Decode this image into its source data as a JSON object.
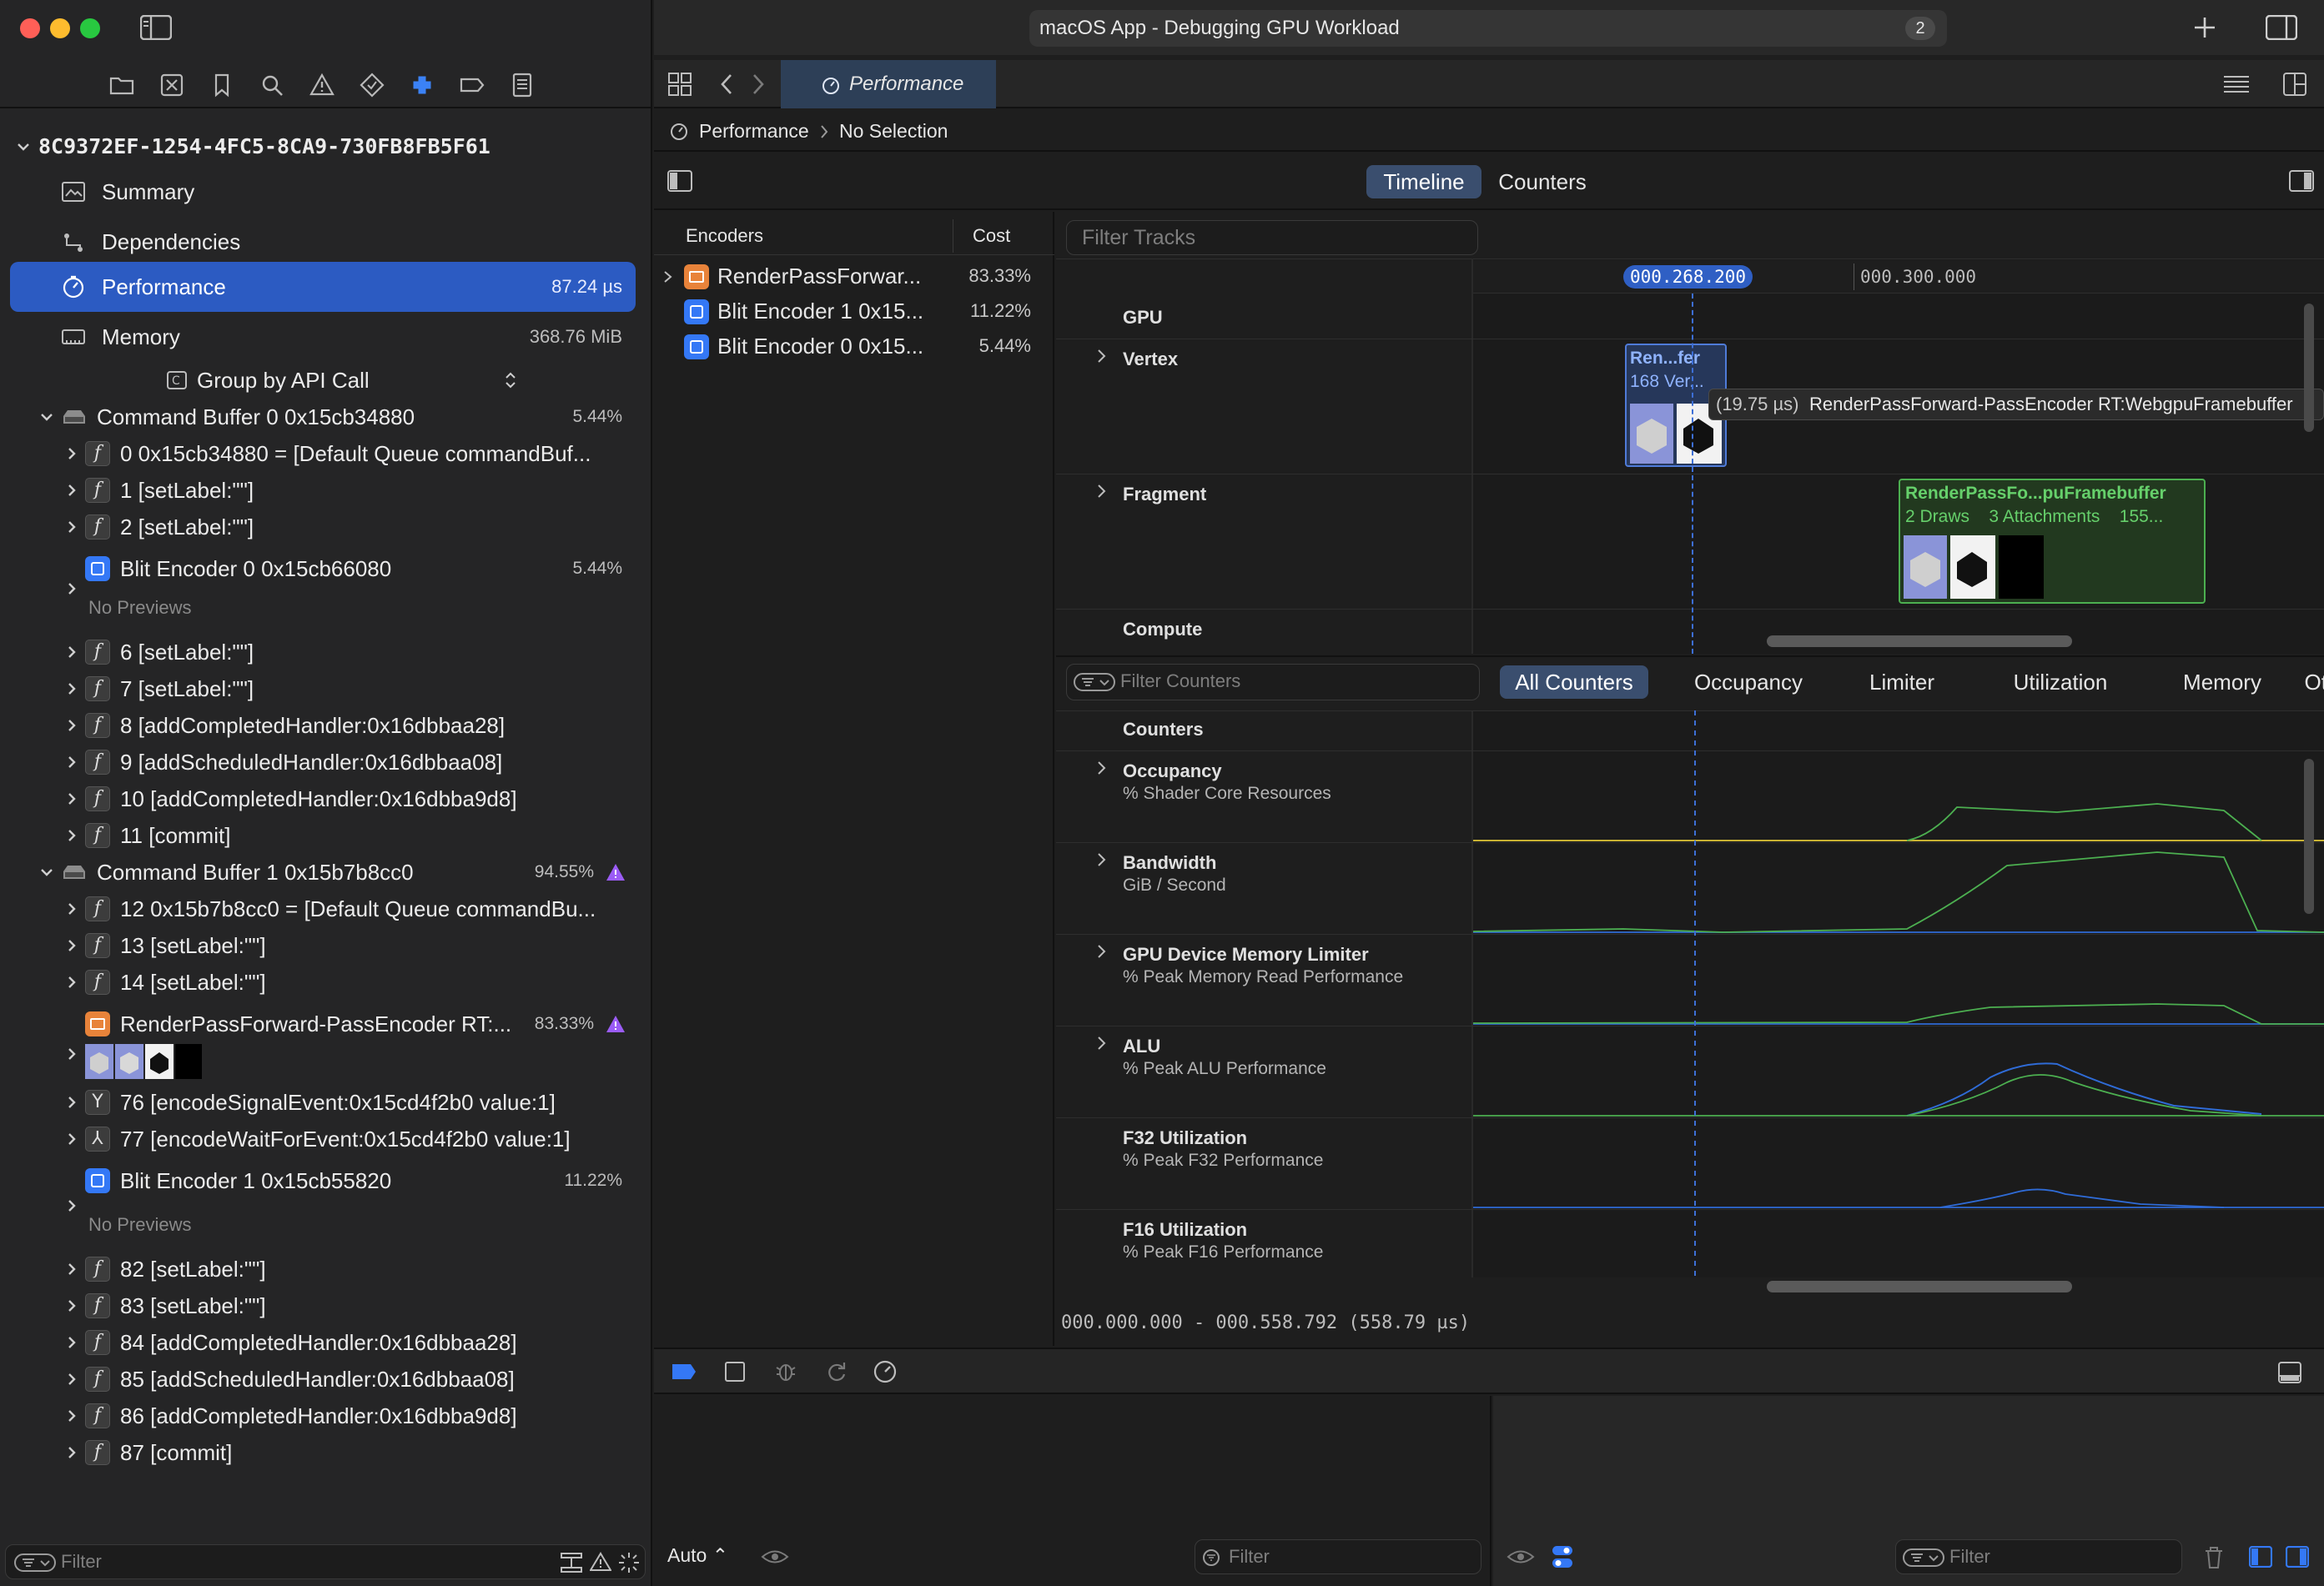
{
  "window": {
    "title": "macOS App - Debugging GPU Workload",
    "badge": "2",
    "colors": {
      "close": "#ff5f57",
      "minimize": "#febc2e",
      "zoom": "#28c840",
      "accent": "#2f5fc4",
      "selection": "#2c5bc2"
    }
  },
  "navigator": {
    "root": "8C9372EF-1254-4FC5-8CA9-730FB8FB5F61",
    "sections": [
      {
        "label": "Summary",
        "icon": "summary-icon",
        "value": ""
      },
      {
        "label": "Dependencies",
        "icon": "dependencies-icon",
        "value": ""
      },
      {
        "label": "Performance",
        "icon": "performance-icon",
        "value": "87.24 µs"
      },
      {
        "label": "Memory",
        "icon": "memory-icon",
        "value": "368.76 MiB"
      }
    ],
    "group_by": "Group by API Call",
    "command_buffer_0": {
      "label": "Command Buffer 0 0x15cb34880",
      "pct": "5.44%"
    },
    "cb0_calls": [
      "0 0x15cb34880 = [Default Queue commandBuf...",
      "1 [setLabel:\"\"]",
      "2 [setLabel:\"\"]"
    ],
    "blit0": {
      "label": "Blit Encoder 0 0x15cb66080",
      "pct": "5.44%",
      "no_previews": "No Previews"
    },
    "cb0_calls_b": [
      "6 [setLabel:\"\"]",
      "7 [setLabel:\"\"]",
      "8 [addCompletedHandler:0x16dbbaa28]",
      "9 [addScheduledHandler:0x16dbbaa08]",
      "10 [addCompletedHandler:0x16dbba9d8]",
      "11 [commit]"
    ],
    "command_buffer_1": {
      "label": "Command Buffer 1 0x15b7b8cc0",
      "pct": "94.55%"
    },
    "cb1_calls": [
      "12 0x15b7b8cc0 = [Default Queue commandBu...",
      "13 [setLabel:\"\"]",
      "14 [setLabel:\"\"]"
    ],
    "render_pass": {
      "label": "RenderPassForward-PassEncoder RT:...",
      "pct": "83.33%"
    },
    "cb1_events": [
      "76 [encodeSignalEvent:0x15cd4f2b0 value:1]",
      "77 [encodeWaitForEvent:0x15cd4f2b0 value:1]"
    ],
    "blit1": {
      "label": "Blit Encoder 1 0x15cb55820",
      "pct": "11.22%",
      "no_previews": "No Previews"
    },
    "cb1_calls_b": [
      "82 [setLabel:\"\"]",
      "83 [setLabel:\"\"]",
      "84 [addCompletedHandler:0x16dbbaa28]",
      "85 [addScheduledHandler:0x16dbbaa08]",
      "86 [addCompletedHandler:0x16dbba9d8]",
      "87 [commit]"
    ],
    "filter_placeholder": "Filter"
  },
  "editor": {
    "tab": "Performance",
    "breadcrumb": {
      "root": "Performance",
      "selection": "No Selection"
    },
    "view_tabs": [
      "Timeline",
      "Counters"
    ],
    "encoders_header": {
      "name": "Encoders",
      "cost": "Cost"
    },
    "encoders": [
      {
        "label": "RenderPassForwar...",
        "pct": "83.33%",
        "color": "#e8833a"
      },
      {
        "label": "Blit Encoder 1 0x15...",
        "pct": "11.22%",
        "color": "#3478f6"
      },
      {
        "label": "Blit Encoder 0 0x15...",
        "pct": "5.44%",
        "color": "#3478f6"
      }
    ],
    "filter_tracks": "Filter Tracks",
    "time_cursor": "000.268.200",
    "time_mark": "000.300.000",
    "tracks": [
      "GPU",
      "Vertex",
      "Fragment",
      "Compute"
    ],
    "vertex_block": {
      "title": "Ren...fer",
      "sub": "168 Ver...",
      "tooltip_time": "(19.75 µs)",
      "tooltip_label": "RenderPassForward-PassEncoder RT:WebgpuFramebuffer"
    },
    "fragment_block": {
      "title": "RenderPassFo...puFramebuffer",
      "sub": "2 Draws    3 Attachments    155..."
    },
    "filter_counters": "Filter Counters",
    "counter_tabs": [
      "All Counters",
      "Occupancy",
      "Limiter",
      "Utilization",
      "Memory",
      "Other"
    ],
    "counters_header": "Counters",
    "counters": [
      {
        "name": "Occupancy",
        "sub": "% Shader Core Resources",
        "expandable": true
      },
      {
        "name": "Bandwidth",
        "sub": "GiB / Second",
        "expandable": true
      },
      {
        "name": "GPU Device Memory Limiter",
        "sub": "% Peak Memory Read Performance",
        "expandable": true
      },
      {
        "name": "ALU",
        "sub": "% Peak ALU Performance",
        "expandable": true
      },
      {
        "name": "F32 Utilization",
        "sub": "% Peak F32 Performance",
        "expandable": false
      },
      {
        "name": "F16 Utilization",
        "sub": "% Peak F16 Performance",
        "expandable": false
      }
    ],
    "range": "000.000.000 - 000.558.792 (558.79 µs)"
  },
  "debug": {
    "auto": "Auto",
    "filter_placeholder": "Filter"
  }
}
